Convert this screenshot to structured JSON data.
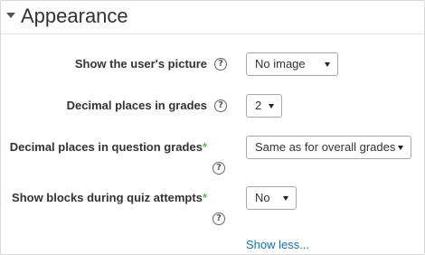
{
  "section": {
    "title": "Appearance"
  },
  "fields": [
    {
      "label": "Show the user's picture",
      "required": false,
      "value": "No image"
    },
    {
      "label": "Decimal places in grades",
      "required": false,
      "value": "2"
    },
    {
      "label": "Decimal places in question grades",
      "required": true,
      "value": "Same as for overall grades"
    },
    {
      "label": "Show blocks during quiz attempts",
      "required": true,
      "value": "No"
    }
  ],
  "help_symbol": "?",
  "required_marker": "*",
  "show_less_label": "Show less...",
  "icons": {
    "section_toggle": "chevron-down-icon",
    "help": "help-icon",
    "select_arrow": "dropdown-arrow-icon"
  },
  "colors": {
    "link": "#0f6fc5",
    "required": "#5cb85c",
    "text": "#333333"
  }
}
